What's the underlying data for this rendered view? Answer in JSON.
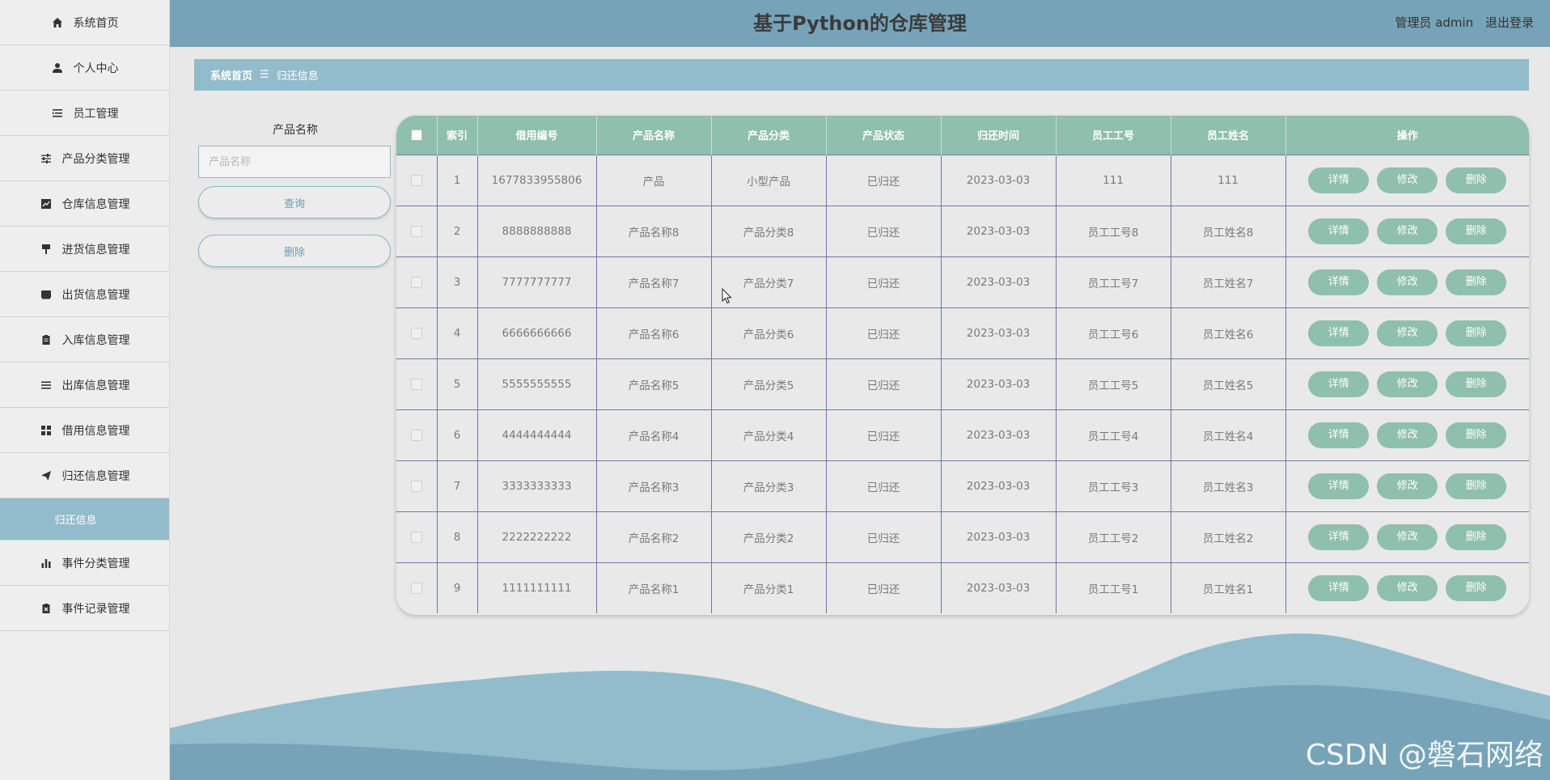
{
  "header": {
    "title": "基于Python的仓库管理",
    "user_label": "管理员 admin",
    "logout_label": "退出登录"
  },
  "sidebar": {
    "items": [
      {
        "label": "系统首页",
        "icon": "home-icon"
      },
      {
        "label": "个人中心",
        "icon": "user-icon"
      },
      {
        "label": "员工管理",
        "icon": "list-indent-icon"
      },
      {
        "label": "产品分类管理",
        "icon": "sliders-icon"
      },
      {
        "label": "仓库信息管理",
        "icon": "line-chart-icon"
      },
      {
        "label": "进货信息管理",
        "icon": "paint-roller-icon"
      },
      {
        "label": "出货信息管理",
        "icon": "inbox-icon"
      },
      {
        "label": "入库信息管理",
        "icon": "clipboard-icon"
      },
      {
        "label": "出库信息管理",
        "icon": "menu-lines-icon"
      },
      {
        "label": "借用信息管理",
        "icon": "grid-icon"
      },
      {
        "label": "归还信息管理",
        "icon": "send-icon"
      },
      {
        "label": "归还信息",
        "icon": ""
      },
      {
        "label": "事件分类管理",
        "icon": "bar-chart-icon"
      },
      {
        "label": "事件记录管理",
        "icon": "clipboard-x-icon"
      }
    ]
  },
  "breadcrumb": {
    "home": "系统首页",
    "separator": "☰",
    "current": "归还信息"
  },
  "search": {
    "label": "产品名称",
    "placeholder": "产品名称",
    "query_label": "查询",
    "delete_label": "删除"
  },
  "table": {
    "columns": [
      "索引",
      "借用编号",
      "产品名称",
      "产品分类",
      "产品状态",
      "归还时间",
      "员工工号",
      "员工姓名",
      "操作"
    ],
    "actions": {
      "detail": "详情",
      "edit": "修改",
      "delete": "删除"
    },
    "rows": [
      [
        "1",
        "1677833955806",
        "产品",
        "小型产品",
        "已归还",
        "2023-03-03",
        "111",
        "111"
      ],
      [
        "2",
        "8888888888",
        "产品名称8",
        "产品分类8",
        "已归还",
        "2023-03-03",
        "员工工号8",
        "员工姓名8"
      ],
      [
        "3",
        "7777777777",
        "产品名称7",
        "产品分类7",
        "已归还",
        "2023-03-03",
        "员工工号7",
        "员工姓名7"
      ],
      [
        "4",
        "6666666666",
        "产品名称6",
        "产品分类6",
        "已归还",
        "2023-03-03",
        "员工工号6",
        "员工姓名6"
      ],
      [
        "5",
        "5555555555",
        "产品名称5",
        "产品分类5",
        "已归还",
        "2023-03-03",
        "员工工号5",
        "员工姓名5"
      ],
      [
        "6",
        "4444444444",
        "产品名称4",
        "产品分类4",
        "已归还",
        "2023-03-03",
        "员工工号4",
        "员工姓名4"
      ],
      [
        "7",
        "3333333333",
        "产品名称3",
        "产品分类3",
        "已归还",
        "2023-03-03",
        "员工工号3",
        "员工姓名3"
      ],
      [
        "8",
        "2222222222",
        "产品名称2",
        "产品分类2",
        "已归还",
        "2023-03-03",
        "员工工号2",
        "员工姓名2"
      ],
      [
        "9",
        "1111111111",
        "产品名称1",
        "产品分类1",
        "已归还",
        "2023-03-03",
        "员工工号1",
        "员工姓名1"
      ]
    ]
  },
  "watermark": "CSDN @磐石网络",
  "colors": {
    "header_bg": "#76a3b8",
    "accent": "#92bccb",
    "table_header": "#8fbfad",
    "wave_light": "#92bccb",
    "wave_dark": "#76a3b8"
  }
}
